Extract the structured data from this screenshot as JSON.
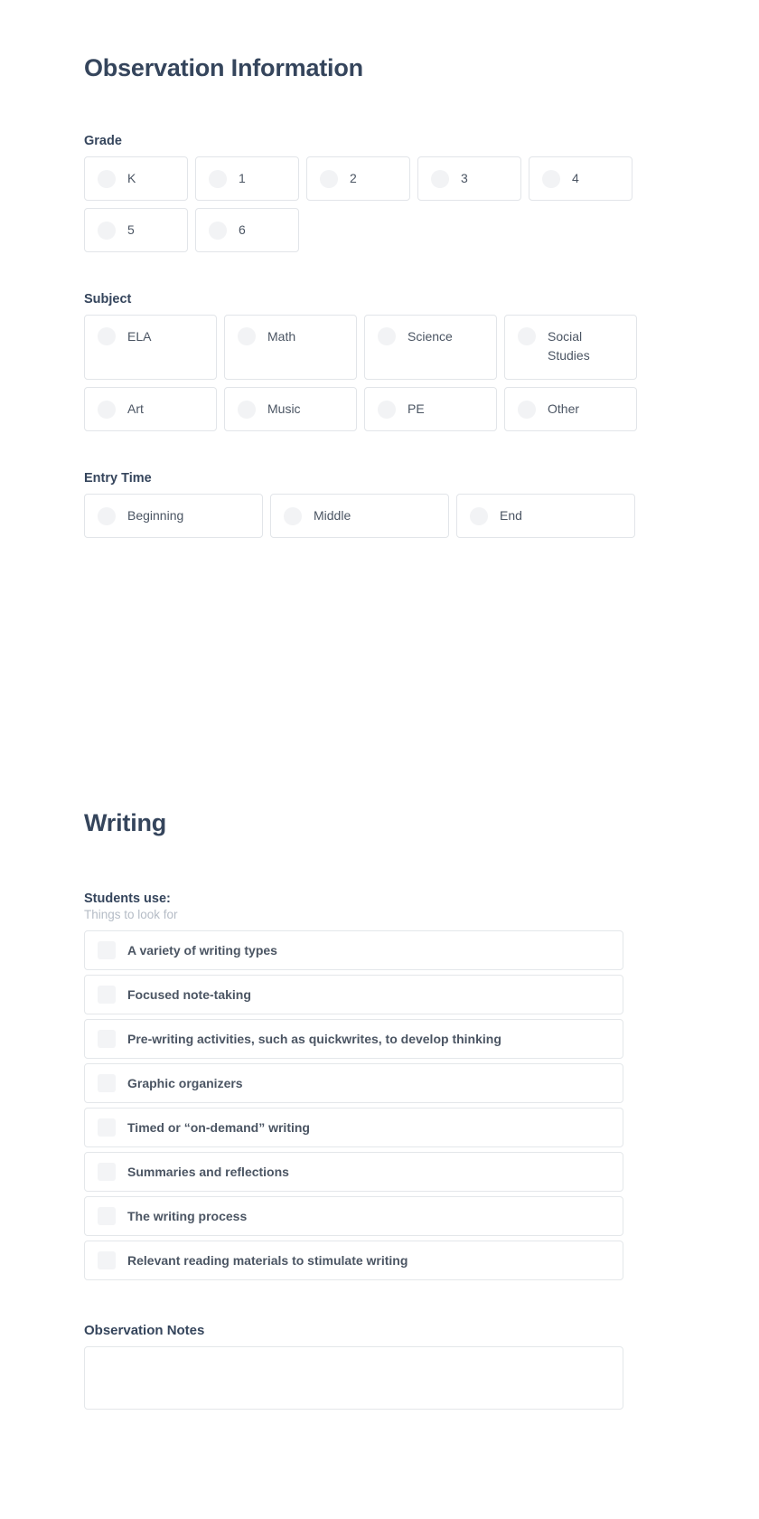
{
  "sections": {
    "observation": {
      "title": "Observation Information",
      "grade": {
        "label": "Grade",
        "options": [
          "K",
          "1",
          "2",
          "3",
          "4",
          "5",
          "6"
        ]
      },
      "subject": {
        "label": "Subject",
        "options": [
          "ELA",
          "Math",
          "Science",
          "Social Studies",
          "Art",
          "Music",
          "PE",
          "Other"
        ]
      },
      "entry_time": {
        "label": "Entry Time",
        "options": [
          "Beginning",
          "Middle",
          "End"
        ]
      }
    },
    "writing": {
      "title": "Writing",
      "students_use": {
        "label": "Students use:",
        "sublabel": "Things to look for",
        "items": [
          "A variety of writing types",
          "Focused note-taking",
          "Pre-writing activities, such as quickwrites, to develop thinking",
          "Graphic organizers",
          "Timed or “on-demand” writing",
          "Summaries and reflections",
          "The writing process",
          "Relevant reading materials to stimulate writing"
        ]
      },
      "notes": {
        "label": "Observation Notes",
        "value": ""
      }
    }
  },
  "colors": {
    "heading": "#35455c",
    "body_text": "#4b5563",
    "muted_text": "#b5bcc6",
    "border": "#e4e7ea",
    "control_fill": "#f2f3f5",
    "background": "#ffffff"
  }
}
